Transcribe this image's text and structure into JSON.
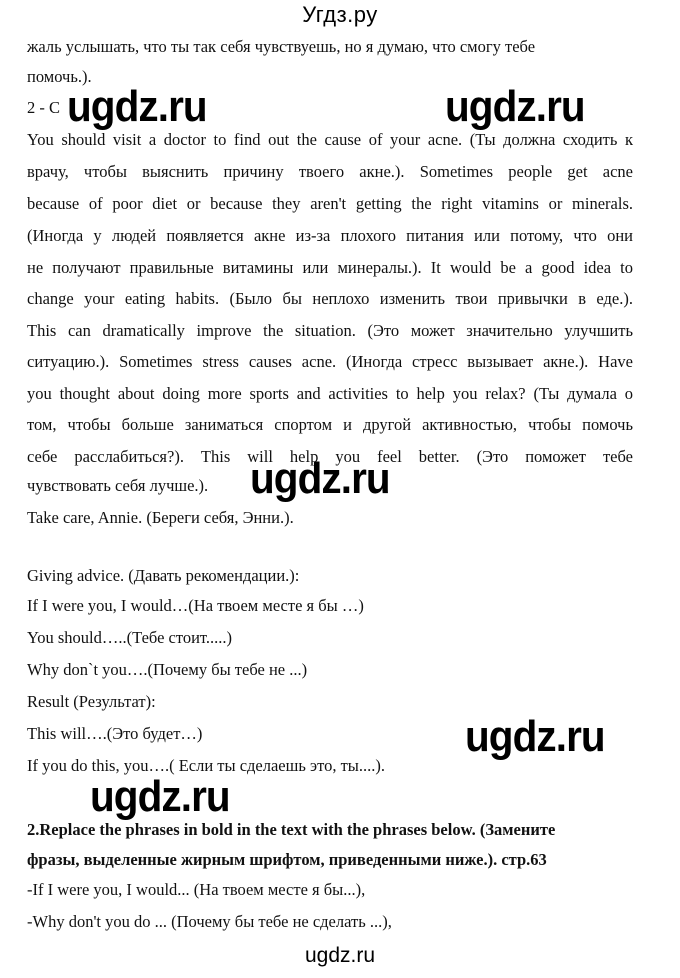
{
  "header": {
    "site_title": "Угдз.ру"
  },
  "content": {
    "intro_lines": [
      "жаль услышать, что ты так себя чувствуешь, но я думаю, что смогу тебе",
      "помочь.)."
    ],
    "answer_label": "2 - C",
    "letter_lines": [
      "You should visit a doctor to find out the cause of your acne. (Ты должна сходить к",
      "врачу, чтобы выяснить причину твоего акне.). Sometimes people get acne",
      "because of poor diet or because they aren't getting the right vitamins or minerals.",
      "(Иногда у людей появляется акне из-за плохого питания или потому, что они",
      "не получают правильные витамины или минералы.). It  would be a good idea to",
      "change your eating habits. (Было бы неплохо изменить твои привычки в еде.).",
      "This can dramatically improve the situation. (Это может значительно улучшить",
      "ситуацию.). Sometimes stress causes acne. (Иногда стресс вызывает акне.). Have",
      "you thought about doing more sports and activities to help you relax? (Ты думала о",
      "том, чтобы больше заниматься спортом и другой активностью, чтобы помочь",
      "себе расслабиться?). This will help you feel better. (Это поможет тебе",
      "чувствовать себя лучше.)."
    ],
    "sign_off": "Take care, Annie. (Береги себя, Энни.).",
    "phrases": [
      "Giving advice. (Давать рекомендации.):",
      "If I were you, I would…(На твоем месте я бы …)",
      "You should…..(Тебе стоит.....)",
      "Why don`t you….(Почему бы тебе не ...)",
      "Result (Результат):",
      "This will….(Это будет…)",
      "If you do this, you….( Если ты сделаешь это, ты....)."
    ],
    "task_heading_lines": [
      "2.Replace the phrases in bold in the text with the phrases below. (Замените",
      "фразы, выделенные жирным шрифтом, приведенными ниже.). стр.63"
    ],
    "task_items": [
      "-If I were you, I would... (На твоем месте я бы...),",
      "-Why don't you do ... (Почему бы тебе не сделать ...),"
    ]
  },
  "watermarks": [
    "ugdz.ru",
    "ugdz.ru",
    "ugdz.ru",
    "ugdz.ru",
    "ugdz.ru"
  ],
  "footer": {
    "site_label": "ugdz.ru"
  }
}
